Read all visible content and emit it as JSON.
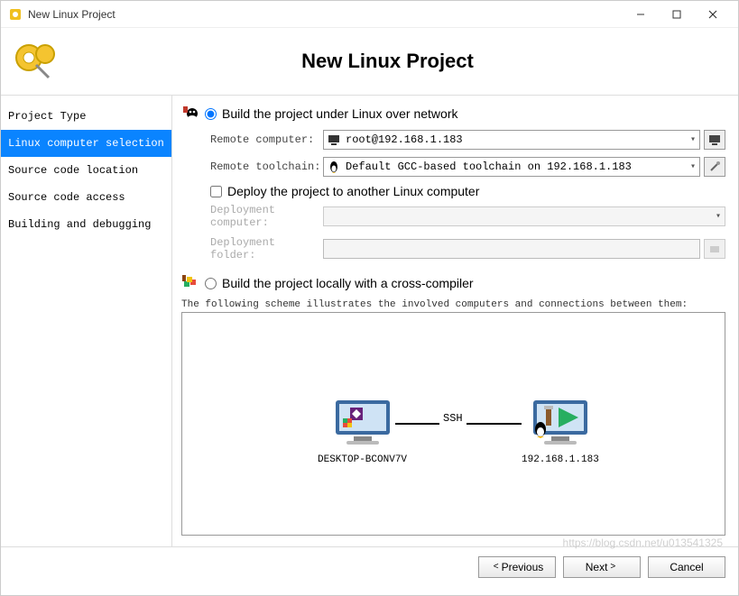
{
  "window": {
    "title": "New Linux Project"
  },
  "header": {
    "title": "New Linux Project"
  },
  "sidebar": {
    "items": [
      {
        "label": "Project Type"
      },
      {
        "label": "Linux computer selection"
      },
      {
        "label": "Source code location"
      },
      {
        "label": "Source code access"
      },
      {
        "label": "Building and debugging"
      }
    ],
    "selected_index": 1
  },
  "option_network": {
    "label": "Build the project under Linux over network",
    "checked": true,
    "remote_computer_label": "Remote computer:",
    "remote_computer_value": "root@192.168.1.183",
    "remote_toolchain_label": "Remote toolchain:",
    "remote_toolchain_value": "Default GCC-based toolchain on 192.168.1.183",
    "deploy_check_label": "Deploy the project to another Linux computer",
    "deploy_checked": false,
    "deployment_computer_label": "Deployment computer:",
    "deployment_folder_label": "Deployment folder:"
  },
  "option_local": {
    "label": "Build the project locally with a cross-compiler",
    "checked": false
  },
  "scheme": {
    "caption": "The following scheme illustrates the involved computers and connections between them:",
    "left_label": "DESKTOP-BCONV7V",
    "conn_label": "SSH",
    "right_label": "192.168.1.183"
  },
  "footer": {
    "previous": "Previous",
    "next": "Next",
    "cancel": "Cancel"
  },
  "watermark": "https://blog.csdn.net/u013541325"
}
